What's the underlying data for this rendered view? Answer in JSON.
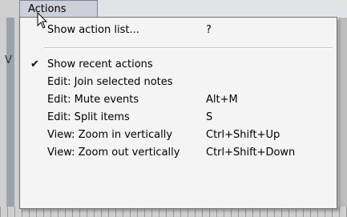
{
  "menubar": {
    "active_menu": "Actions"
  },
  "menu": {
    "items": [
      {
        "label": "Show action list...",
        "shortcut": "?",
        "checked": false
      },
      {
        "label": "Show recent actions",
        "shortcut": "",
        "checked": true
      },
      {
        "label": "Edit: Join selected notes",
        "shortcut": "",
        "checked": false
      },
      {
        "label": "Edit: Mute events",
        "shortcut": "Alt+M",
        "checked": false
      },
      {
        "label": "Edit: Split items",
        "shortcut": "S",
        "checked": false
      },
      {
        "label": "View: Zoom in vertically",
        "shortcut": "Ctrl+Shift+Up",
        "checked": false
      },
      {
        "label": "View: Zoom out vertically",
        "shortcut": "Ctrl+Shift+Down",
        "checked": false
      }
    ]
  },
  "background": {
    "side_letter": "V"
  },
  "icons": {
    "check": "✔"
  }
}
